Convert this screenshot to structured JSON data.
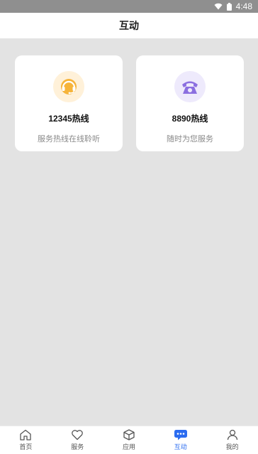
{
  "status_bar": {
    "time": "4:48"
  },
  "header": {
    "title": "互动"
  },
  "cards": [
    {
      "title": "12345热线",
      "subtitle": "服务热线在线聆听",
      "icon": "headset-icon",
      "icon_bg": "#fff1d9",
      "icon_color": "#f4a21b"
    },
    {
      "title": "8890热线",
      "subtitle": "随时为您服务",
      "icon": "telephone-icon",
      "icon_bg": "#eeeafc",
      "icon_color": "#8b6fe0"
    }
  ],
  "tabs": [
    {
      "label": "首页",
      "icon": "home-icon",
      "active": false
    },
    {
      "label": "服务",
      "icon": "heart-icon",
      "active": false
    },
    {
      "label": "应用",
      "icon": "cube-icon",
      "active": false
    },
    {
      "label": "互动",
      "icon": "chat-icon",
      "active": true
    },
    {
      "label": "我的",
      "icon": "person-icon",
      "active": false
    }
  ],
  "colors": {
    "accent": "#2b6cf0",
    "status_bar": "#8f8f8f"
  }
}
